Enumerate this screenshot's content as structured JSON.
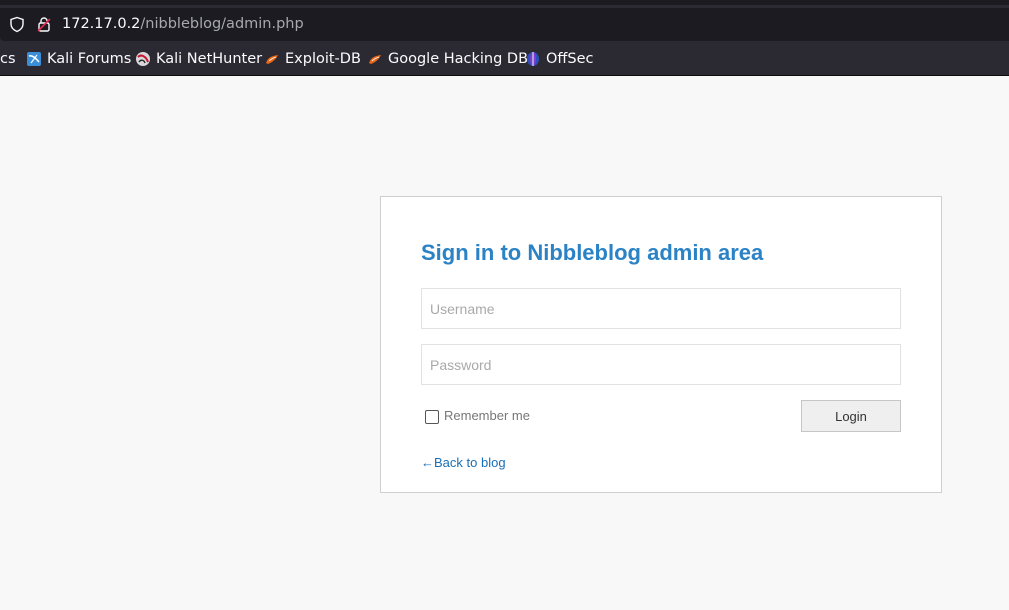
{
  "browser": {
    "url_host": "172.17.0.2",
    "url_path": "/nibbleblog/admin.php",
    "bookmarks": [
      {
        "label": "cs",
        "icon": "truncated"
      },
      {
        "label": "Kali Forums",
        "icon": "kali-forums-icon"
      },
      {
        "label": "Kali NetHunter",
        "icon": "kali-nethunter-icon"
      },
      {
        "label": "Exploit-DB",
        "icon": "exploit-db-icon"
      },
      {
        "label": "Google Hacking DB",
        "icon": "exploit-db-icon"
      },
      {
        "label": "OffSec",
        "icon": "offsec-icon"
      }
    ]
  },
  "login": {
    "title": "Sign in to Nibbleblog admin area",
    "username_placeholder": "Username",
    "username_value": "",
    "password_placeholder": "Password",
    "password_value": "",
    "remember_label": "Remember me",
    "remember_checked": false,
    "submit_label": "Login",
    "back_link": "←Back to blog"
  },
  "colors": {
    "title": "#2b83c6",
    "link": "#1a6fb5",
    "chrome": "#2b2a33",
    "page_bg": "#f8f8f8"
  }
}
